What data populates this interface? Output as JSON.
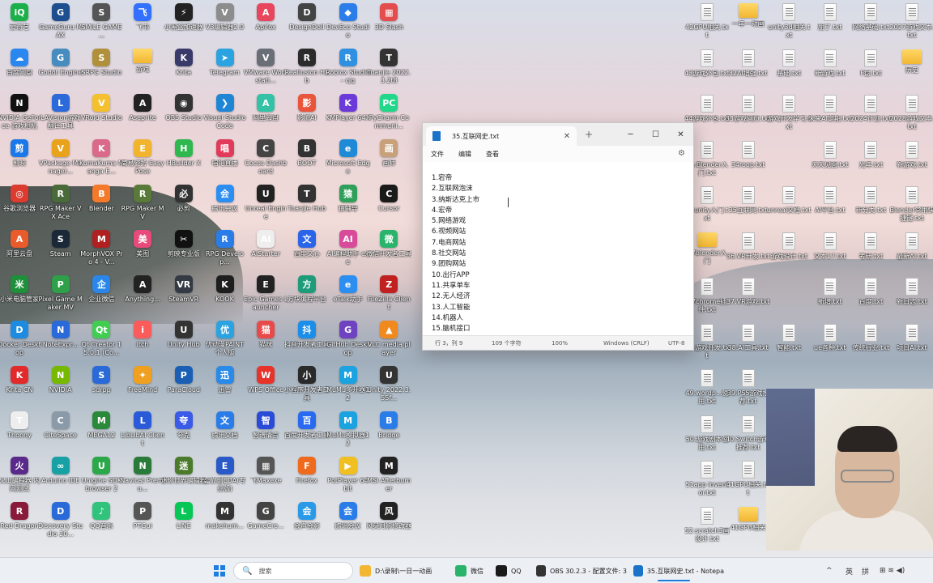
{
  "desktop": {
    "icons_left": [
      {
        "label": "爱奇艺",
        "color": "#1bb04a",
        "glyph": "iQ"
      },
      {
        "label": "GameGuru MAX",
        "color": "#1d4e8f",
        "glyph": "G"
      },
      {
        "label": "SMILE GAME ...",
        "color": "#555555",
        "glyph": "S"
      },
      {
        "label": "飞书",
        "color": "#3370ff",
        "glyph": "飞"
      },
      {
        "label": "小黑盒加速器",
        "color": "#222222",
        "glyph": "⚡"
      },
      {
        "label": "V3编辑器2.0",
        "color": "#8c8c8c",
        "glyph": "V"
      },
      {
        "label": "Apifox",
        "color": "#e8465d",
        "glyph": "A"
      },
      {
        "label": "DesignDoll",
        "color": "#444444",
        "glyph": "D"
      },
      {
        "label": "DevEco Studio",
        "color": "#2b7de9",
        "glyph": "◆"
      },
      {
        "label": "3D Slash",
        "color": "#e34d4d",
        "glyph": "▦"
      },
      {
        "label": "百度网盘",
        "color": "#2a87f0",
        "glyph": "☁"
      },
      {
        "label": "Godot Engine",
        "color": "#478cbf",
        "glyph": "G"
      },
      {
        "label": "SRPG Studio",
        "color": "#b0903a",
        "glyph": "S"
      },
      {
        "label": "游戏",
        "color": "#f2b632",
        "glyph": ""
      },
      {
        "label": "Krita",
        "color": "#3a3a6a",
        "glyph": "K"
      },
      {
        "label": "Telegram",
        "color": "#2aa3e0",
        "glyph": "➤"
      },
      {
        "label": "VMware Workstati...",
        "color": "#6a6e76",
        "glyph": "V"
      },
      {
        "label": "Reallusion Hub",
        "color": "#2b2b2b",
        "glyph": "R"
      },
      {
        "label": "Roblox Studio - cjq",
        "color": "#2f8fe0",
        "glyph": "R"
      },
      {
        "label": "Tuanjie 2022.3.2t8",
        "color": "#333333",
        "glyph": "T"
      },
      {
        "label": "NVIDIA GeForce 游戏相机",
        "color": "#111111",
        "glyph": "N"
      },
      {
        "label": "LAVision游戏翻译工具",
        "color": "#2b6ad8",
        "glyph": "L"
      },
      {
        "label": "VRoid Studio",
        "color": "#f4c02d",
        "glyph": "V"
      },
      {
        "label": "Aseprite",
        "color": "#222222",
        "glyph": "A"
      },
      {
        "label": "OBS Studio",
        "color": "#333333",
        "glyph": "◉"
      },
      {
        "label": "Visual Studio Code",
        "color": "#1f86d6",
        "glyph": "❯"
      },
      {
        "label": "阿里云盘",
        "color": "#34c2a6",
        "glyph": "A"
      },
      {
        "label": "影流AI",
        "color": "#e9553b",
        "glyph": "影"
      },
      {
        "label": "KMPlayer 64X",
        "color": "#6b3ad8",
        "glyph": "K"
      },
      {
        "label": "PyCharm Communi...",
        "color": "#21d789",
        "glyph": "PC"
      },
      {
        "label": "剪映",
        "color": "#1b78e8",
        "glyph": "剪"
      },
      {
        "label": "VPackage Manager...",
        "color": "#e8a21b",
        "glyph": "V"
      },
      {
        "label": "KumaKuma Manga E...",
        "color": "#d96a8a",
        "glyph": "K"
      },
      {
        "label": "简易姿势 Easy Pose",
        "color": "#f3b42d",
        "glyph": "E"
      },
      {
        "label": "HBuilder X",
        "color": "#2fb84f",
        "glyph": "H"
      },
      {
        "label": "唱吧直播",
        "color": "#e23a5a",
        "glyph": "唱"
      },
      {
        "label": "Cocos Dashboard",
        "color": "#444444",
        "glyph": "C"
      },
      {
        "label": "BOOT",
        "color": "#333333",
        "glyph": "B"
      },
      {
        "label": "Microsoft Edge",
        "color": "#1f8bd6",
        "glyph": "e"
      },
      {
        "label": "画师",
        "color": "#c8a07a",
        "glyph": "画"
      },
      {
        "label": "谷歌浏览器",
        "color": "#dd3b30",
        "glyph": "◎"
      },
      {
        "label": "RPG Maker VX Ace",
        "color": "#4a6a3a",
        "glyph": "R"
      },
      {
        "label": "Blender",
        "color": "#f5792a",
        "glyph": "B"
      },
      {
        "label": "RPG Maker MV",
        "color": "#5a7a3a",
        "glyph": "R"
      },
      {
        "label": "必剪",
        "color": "#333333",
        "glyph": "必"
      },
      {
        "label": "腾讯会议",
        "color": "#2d8ef2",
        "glyph": "会"
      },
      {
        "label": "Unreal Engine",
        "color": "#222222",
        "glyph": "U"
      },
      {
        "label": "Tuanjie Hub",
        "color": "#333333",
        "glyph": "T"
      },
      {
        "label": "猿辅导",
        "color": "#2f9f5a",
        "glyph": "猿"
      },
      {
        "label": "Cursor",
        "color": "#1a1a1a",
        "glyph": "C"
      },
      {
        "label": "阿里云盘",
        "color": "#ea5b2c",
        "glyph": "A"
      },
      {
        "label": "Steam",
        "color": "#1b2838",
        "glyph": "S"
      },
      {
        "label": "MorphVOX Pro 4 - V...",
        "color": "#b02020",
        "glyph": "M"
      },
      {
        "label": "美图",
        "color": "#e84a7a",
        "glyph": "美"
      },
      {
        "label": "剪映专业版",
        "color": "#111111",
        "glyph": "✂"
      },
      {
        "label": "RPG Develop...",
        "color": "#2a7de8",
        "glyph": "R"
      },
      {
        "label": "AIStarter",
        "color": "#eeeeee",
        "glyph": "AI"
      },
      {
        "label": "百度文心",
        "color": "#2a64e8",
        "glyph": "文"
      },
      {
        "label": "AI编程助手 exe",
        "color": "#d84a9a",
        "glyph": "AI"
      },
      {
        "label": "微信开发者工具",
        "color": "#2ab36a",
        "glyph": "微"
      },
      {
        "label": "小米电脑管家",
        "color": "#1e8f3a",
        "glyph": "米"
      },
      {
        "label": "Pixel Game Maker MV",
        "color": "#2f9f4a",
        "glyph": "P"
      },
      {
        "label": "企业微信",
        "color": "#2a86e8",
        "glyph": "企"
      },
      {
        "label": "Anything...",
        "color": "#222222",
        "glyph": "A"
      },
      {
        "label": "SteamVR",
        "color": "#333a44",
        "glyph": "VR"
      },
      {
        "label": "KOOK",
        "color": "#1e1e1e",
        "glyph": "K"
      },
      {
        "label": "Epic Games Launcher",
        "color": "#222222",
        "glyph": "E"
      },
      {
        "label": "方块编程平台",
        "color": "#1e9c7a",
        "glyph": "方"
      },
      {
        "label": "eTalk助手",
        "color": "#2b8ef0",
        "glyph": "e"
      },
      {
        "label": "FileZilla Client",
        "color": "#c02020",
        "glyph": "Z"
      },
      {
        "label": "Docker Desktop",
        "color": "#1d8ce0",
        "glyph": "D"
      },
      {
        "label": "NoteExpr...",
        "color": "#2a6ad8",
        "glyph": "N"
      },
      {
        "label": "Qt Creator 15.0.1 (Co...",
        "color": "#41cd52",
        "glyph": "Qt"
      },
      {
        "label": "itch",
        "color": "#fa5c5c",
        "glyph": "i"
      },
      {
        "label": "Unity Hub",
        "color": "#333333",
        "glyph": "U"
      },
      {
        "label": "优动漫PAINT 个人版",
        "color": "#2aa3e0",
        "glyph": "优"
      },
      {
        "label": "猫咪",
        "color": "#e84a4a",
        "glyph": "猫"
      },
      {
        "label": "抖音开发者工具",
        "color": "#1a8ee8",
        "glyph": "抖"
      },
      {
        "label": "GitHub Desktop",
        "color": "#6f42c1",
        "glyph": "G"
      },
      {
        "label": "VLC media player",
        "color": "#f08a1e",
        "glyph": "▲"
      },
      {
        "label": "Krita CN",
        "color": "#e22a2a",
        "glyph": "K"
      },
      {
        "label": "NVIDIA",
        "color": "#76b900",
        "glyph": "N"
      },
      {
        "label": "sdrpp",
        "color": "#2a6ad8",
        "glyph": "S"
      },
      {
        "label": "FreeMind",
        "color": "#f0a020",
        "glyph": "✦"
      },
      {
        "label": "ParaCloud",
        "color": "#1a5fb4",
        "glyph": "P"
      },
      {
        "label": "迅雷",
        "color": "#2a8ae8",
        "glyph": "迅"
      },
      {
        "label": "WPS Office",
        "color": "#e8332a",
        "glyph": "W"
      },
      {
        "label": "小程序开发者工具",
        "color": "#2a2a2a",
        "glyph": "小"
      },
      {
        "label": "MuMu多开器12",
        "color": "#1aa3e0",
        "glyph": "M"
      },
      {
        "label": "Unity 2022.3.55f...",
        "color": "#333333",
        "glyph": "U"
      },
      {
        "label": "Thonny",
        "color": "#eeeeee",
        "glyph": "T"
      },
      {
        "label": "CiteSpace",
        "color": "#8a9aa8",
        "glyph": "C"
      },
      {
        "label": "MEGA12",
        "color": "#2a8a3a",
        "glyph": "M"
      },
      {
        "label": "LibLibAI Client",
        "color": "#2a5ad8",
        "glyph": "L"
      },
      {
        "label": "夸克",
        "color": "#3a5ae8",
        "glyph": "夸"
      },
      {
        "label": "腾讯文档",
        "color": "#2a7de8",
        "glyph": "文"
      },
      {
        "label": "智谱清言",
        "color": "#2a4ad8",
        "glyph": "智"
      },
      {
        "label": "百度开发者工具",
        "color": "#2a6af0",
        "glyph": "百"
      },
      {
        "label": "MuMu模拟器12",
        "color": "#1aa3e0",
        "glyph": "M"
      },
      {
        "label": "Bridge",
        "color": "#2a7de8",
        "glyph": "B"
      },
      {
        "label": "火山编程器 内网测试",
        "color": "#5a2a8a",
        "glyph": "火"
      },
      {
        "label": "Arduino IDE",
        "color": "#17a1a5",
        "glyph": "∞"
      },
      {
        "label": "Unigine SDK browser 2",
        "color": "#2aa84a",
        "glyph": "U"
      },
      {
        "label": "Navicat Premiu...",
        "color": "#2a7a3a",
        "glyph": "N"
      },
      {
        "label": "迷你世界编辑器",
        "color": "#4a7a2a",
        "glyph": "迷"
      },
      {
        "label": "嘉立创EDA(专业版)",
        "color": "#2a5ac8",
        "glyph": "E"
      },
      {
        "label": "飞Maxexe",
        "color": "#555555",
        "glyph": "▦"
      },
      {
        "label": "Firefox",
        "color": "#f06a1e",
        "glyph": "F"
      },
      {
        "label": "PotPlayer 64 bit",
        "color": "#f0c020",
        "glyph": "▶"
      },
      {
        "label": "MSI Afterburner",
        "color": "#222222",
        "glyph": "M"
      },
      {
        "label": "Red Dragon",
        "color": "#8a1a3a",
        "glyph": "R"
      },
      {
        "label": "Discovery Studio 20...",
        "color": "#2a6ad8",
        "glyph": "D"
      },
      {
        "label": "QQ音乐",
        "color": "#31c27c",
        "glyph": "♪"
      },
      {
        "label": "PTGui",
        "color": "#555555",
        "glyph": "P"
      },
      {
        "label": "LINE",
        "color": "#06c755",
        "glyph": "L"
      },
      {
        "label": "makehum...",
        "color": "#333333",
        "glyph": "M"
      },
      {
        "label": "GameCre...",
        "color": "#444444",
        "glyph": "G"
      },
      {
        "label": "会声会影",
        "color": "#2a9ae8",
        "glyph": "会"
      },
      {
        "label": "腾讯会议",
        "color": "#2a7de8",
        "glyph": "会"
      },
      {
        "label": "风灵月影修改器",
        "color": "#222222",
        "glyph": "风"
      }
    ],
    "icons_right": [
      {
        "label": "42GPU相关.txt",
        "type": "txt"
      },
      {
        "label": "一年一动画",
        "type": "folder"
      },
      {
        "label": "unity3d相关.txt",
        "type": "txt"
      },
      {
        "label": "朋了.txt",
        "type": "txt"
      },
      {
        "label": "网络基础.txt",
        "type": "txt"
      },
      {
        "label": "2027游戏文本.txt",
        "type": "txt"
      },
      {
        "label": "43游戏外包.txt",
        "type": "txt"
      },
      {
        "label": "32AI增强.txt",
        "type": "txt"
      },
      {
        "label": "基础.txt",
        "type": "txt"
      },
      {
        "label": "新游戏.txt",
        "type": "txt"
      },
      {
        "label": "F盘.txt",
        "type": "txt"
      },
      {
        "label": "历史",
        "type": "folder"
      },
      {
        "label": "44游戏外包.txt",
        "type": "txt"
      },
      {
        "label": "33游戏网页.txt",
        "type": "txt"
      },
      {
        "label": "游戏开发学习.txt",
        "type": "txt"
      },
      {
        "label": "未来AI定期.txt",
        "type": "txt"
      },
      {
        "label": "2024计划.txt",
        "type": "txt"
      },
      {
        "label": "2028游戏文本.txt",
        "type": "txt"
      },
      {
        "label": "45.Blender入门.txt",
        "type": "txt"
      },
      {
        "label": "34roop.txt",
        "type": "txt"
      },
      {
        "label": "",
        "type": "none"
      },
      {
        "label": "天天见面.txt",
        "type": "txt"
      },
      {
        "label": "光年.txt",
        "type": "txt"
      },
      {
        "label": "新游戏.txt",
        "type": "txt"
      },
      {
        "label": "46unity入门.txt",
        "type": "txt"
      },
      {
        "label": "35互联网.txt",
        "type": "txt"
      },
      {
        "label": "unreal文档.txt",
        "type": "txt"
      },
      {
        "label": "AI平台.txt",
        "type": "txt"
      },
      {
        "label": "新分类.txt",
        "type": "txt"
      },
      {
        "label": "Blender常用快捷键.txt",
        "type": "txt"
      },
      {
        "label": "47blender入门",
        "type": "folder"
      },
      {
        "label": "36.VR开发.txt",
        "type": "txt"
      },
      {
        "label": "游戏设计.txt",
        "type": "txt"
      },
      {
        "label": "文本17.txt",
        "type": "txt"
      },
      {
        "label": "考研.txt",
        "type": "txt"
      },
      {
        "label": "最新AI.txt",
        "type": "txt"
      },
      {
        "label": "47chrome插件.txt",
        "type": "txt"
      },
      {
        "label": "37.VR游戏.txt",
        "type": "txt"
      },
      {
        "label": "",
        "type": "none"
      },
      {
        "label": "新增.txt",
        "type": "txt"
      },
      {
        "label": "百度.txt",
        "type": "txt"
      },
      {
        "label": "新日志.txt",
        "type": "txt"
      },
      {
        "label": "48.游戏开发.txt",
        "type": "txt"
      },
      {
        "label": "38.AI工具.txt",
        "type": "txt"
      },
      {
        "label": "智能.txt",
        "type": "txt"
      },
      {
        "label": "ue各种.txt",
        "type": "txt"
      },
      {
        "label": "传统行业.txt",
        "type": "txt"
      },
      {
        "label": "项目AI.txt",
        "type": "txt"
      },
      {
        "label": "49.wordp...使用.txt",
        "type": "txt"
      },
      {
        "label": "39.PS5游戏推荐.txt",
        "type": "txt"
      },
      {
        "label": "",
        "type": "none"
      },
      {
        "label": "",
        "type": "none"
      },
      {
        "label": "",
        "type": "none"
      },
      {
        "label": "",
        "type": "none"
      },
      {
        "label": "50.游戏剧本使用.txt",
        "type": "txt"
      },
      {
        "label": "40.Switch游戏推荐.txt",
        "type": "txt"
      },
      {
        "label": "",
        "type": "none"
      },
      {
        "label": "",
        "type": "none"
      },
      {
        "label": "",
        "type": "none"
      },
      {
        "label": "",
        "type": "none"
      },
      {
        "label": "51app inventor.txt",
        "type": "txt"
      },
      {
        "label": "41GPU相关.txt",
        "type": "txt"
      },
      {
        "label": "",
        "type": "none"
      },
      {
        "label": "",
        "type": "none"
      },
      {
        "label": "",
        "type": "none"
      },
      {
        "label": "",
        "type": "none"
      },
      {
        "label": "52.scratch3画设计.txt",
        "type": "txt"
      },
      {
        "label": "41GPU相关",
        "type": "folder"
      },
      {
        "label": "",
        "type": "none"
      },
      {
        "label": "",
        "type": "none"
      },
      {
        "label": "",
        "type": "none"
      },
      {
        "label": "",
        "type": "none"
      }
    ]
  },
  "notepad": {
    "tab_title": "35.互联网史.txt",
    "tab_close": "✕",
    "new_tab": "+",
    "minimize": "─",
    "maximize": "☐",
    "close": "✕",
    "menu": {
      "file": "文件",
      "edit": "编辑",
      "view": "查看",
      "settings": "⚙"
    },
    "lines": [
      "1.宕帝",
      "2.互联网泡沫",
      "3.纳斯达克上市",
      "4.宏帝",
      "5.网络游戏",
      "6.视频网站",
      "7.电商网站",
      "8.社交网站",
      "9.团购网站",
      "10.出行APP",
      "11.共享单车",
      "12.无人经济",
      "13.人工智能",
      "14.机器人",
      "15.脑机接口"
    ],
    "status": {
      "position": "行 3，列 9",
      "chars": "109 个字符",
      "zoom": "100%",
      "eol": "Windows (CRLF)",
      "encoding": "UTF-8"
    }
  },
  "taskbar": {
    "search_placeholder": "搜索",
    "search_icon": "🔍",
    "items": [
      {
        "label": "D:\\录制\\一日一动画",
        "color": "#f2b632"
      },
      {
        "label": "微信",
        "color": "#2ab36a"
      },
      {
        "label": "QQ",
        "color": "#1a1a1a"
      },
      {
        "label": "OBS 30.2.3 - 配置文件: 3",
        "color": "#333333"
      },
      {
        "label": "35.互联网史.txt - Notepa",
        "color": "#1a73c8"
      }
    ],
    "tray": {
      "chevron": "^",
      "ime_1": "英",
      "ime_2": "拼",
      "icons": "⊞ ≋ ◀)"
    }
  }
}
